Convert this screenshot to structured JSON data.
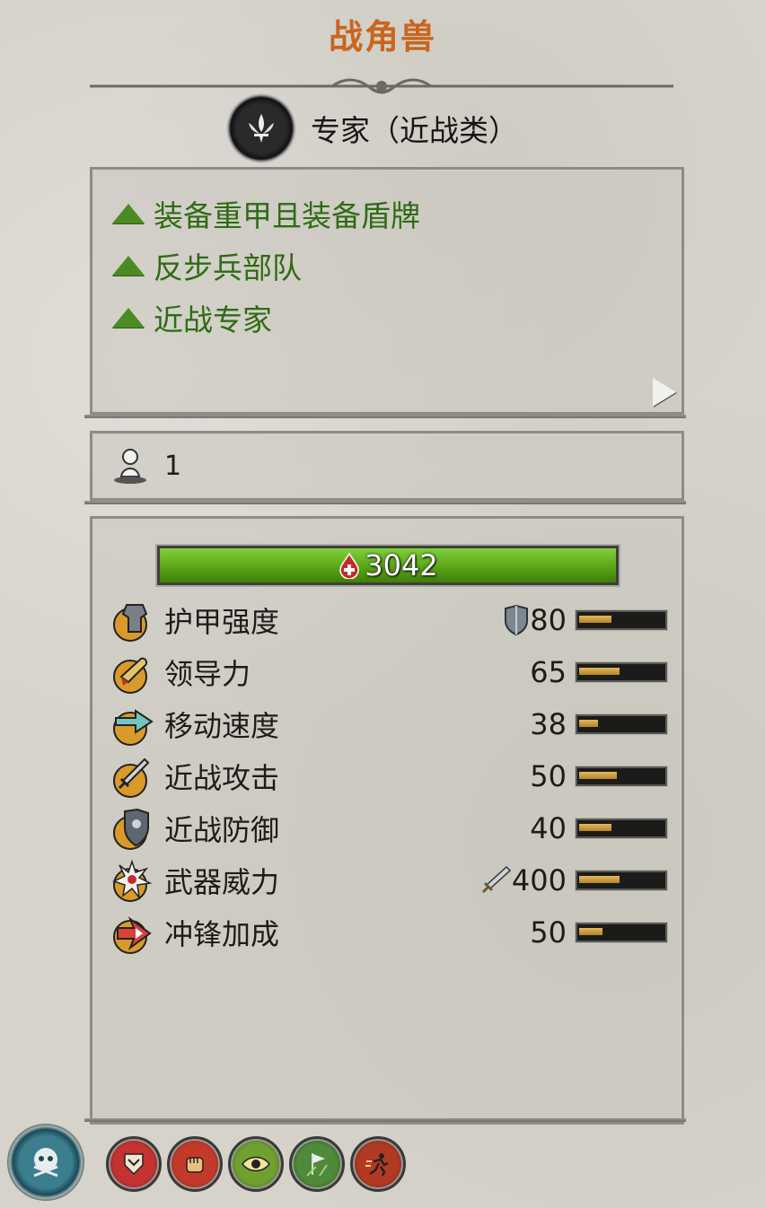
{
  "unit": {
    "title": "战角兽"
  },
  "class": {
    "label": "专家（近战类）",
    "icon": "fleur-emblem-icon"
  },
  "attributes": [
    {
      "text": "装备重甲且装备盾牌",
      "icon": "green-triangle-icon"
    },
    {
      "text": "反步兵部队",
      "icon": "green-triangle-icon"
    },
    {
      "text": "近战专家",
      "icon": "green-triangle-icon"
    }
  ],
  "entities": {
    "count": "1",
    "icon": "soldier-icon"
  },
  "health": {
    "value": "3042",
    "icon": "health-drop-icon",
    "fill": 1.0
  },
  "stats": [
    {
      "label": "护甲强度",
      "value": "80",
      "fill": 0.38,
      "icon": "armour-icon",
      "value_icon": "shield-icon"
    },
    {
      "label": "领导力",
      "value": "65",
      "fill": 0.48,
      "icon": "leadership-icon"
    },
    {
      "label": "移动速度",
      "value": "38",
      "fill": 0.22,
      "icon": "speed-icon"
    },
    {
      "label": "近战攻击",
      "value": "50",
      "fill": 0.45,
      "icon": "melee-attack-icon"
    },
    {
      "label": "近战防御",
      "value": "40",
      "fill": 0.38,
      "icon": "melee-defence-icon"
    },
    {
      "label": "武器威力",
      "value": "400",
      "fill": 0.48,
      "icon": "weapon-strength-icon",
      "value_icon": "sword-icon"
    },
    {
      "label": "冲锋加成",
      "value": "50",
      "fill": 0.28,
      "icon": "charge-bonus-icon"
    }
  ],
  "abilities": [
    {
      "name": "rank-ability-icon",
      "color": "#b22a2a"
    },
    {
      "name": "fist-ability-icon",
      "color": "#b2302a"
    },
    {
      "name": "eye-ability-icon",
      "color": "#5b8a2a"
    },
    {
      "name": "banner-ability-icon",
      "color": "#4f7a3a"
    },
    {
      "name": "runner-ability-icon",
      "color": "#a23020"
    }
  ],
  "special_ability": {
    "icon": "skull-skill-icon"
  },
  "colors": {
    "title": "#c9651d",
    "attribute_text": "#2f6b14",
    "health_bar": "#5aa516"
  }
}
